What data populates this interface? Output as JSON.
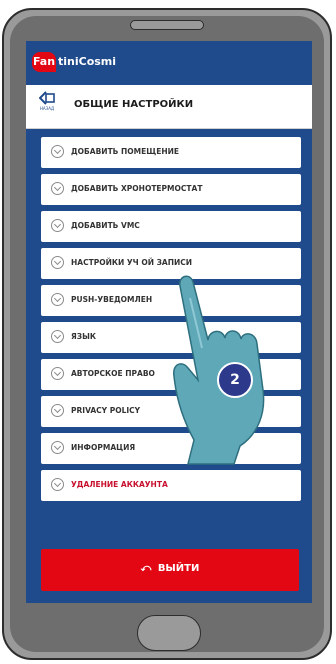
{
  "brand": {
    "logo_mark": "Fan",
    "logo_text": "tiniCosmi",
    "accent": "#e30613",
    "primary": "#1f4a8c"
  },
  "header": {
    "back_label": "НАЗАД",
    "title": "ОБЩИЕ НАСТРОЙКИ",
    "back_icon": "back-arrow-icon"
  },
  "menu": {
    "items": [
      {
        "label": "ДОБАВИТЬ ПОМЕЩЕНИЕ"
      },
      {
        "label": "ДОБАВИТЬ ХРОНОТЕРМОСТАТ"
      },
      {
        "label": "ДОБАВИТЬ VMC"
      },
      {
        "label": "НАСТРОЙКИ УЧ     ОЙ ЗАПИСИ"
      },
      {
        "label": "PUSH-УВЕДОМЛЕН"
      },
      {
        "label": "ЯЗЫК"
      },
      {
        "label": "АВТОРСКОЕ ПРАВО"
      },
      {
        "label": "PRIVACY POLICY"
      },
      {
        "label": "ИНФОРМАЦИЯ"
      },
      {
        "label": "УДАЛЕНИЕ АККАУНТА"
      }
    ]
  },
  "logout": {
    "label": "ВЫЙТИ",
    "icon": "logout-arrow-icon"
  },
  "overlay": {
    "step_number": "2",
    "hand_icon": "pointing-hand-icon"
  }
}
